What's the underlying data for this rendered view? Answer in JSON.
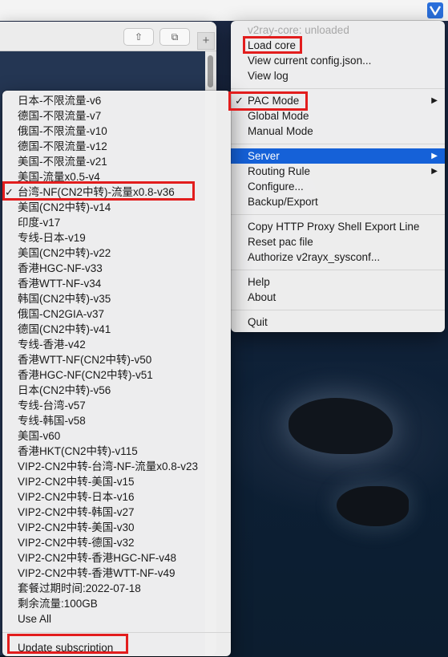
{
  "main_menu": {
    "status": "v2ray-core: unloaded",
    "items_top": [
      "Load core",
      "View current config.json...",
      "View log"
    ],
    "pac_mode": "PAC Mode",
    "global_mode": "Global Mode",
    "manual_mode": "Manual Mode",
    "server": "Server",
    "routing_rule": "Routing Rule",
    "configure": "Configure...",
    "backup_export": "Backup/Export",
    "copy_proxy": "Copy HTTP Proxy Shell Export Line",
    "reset_pac": "Reset pac file",
    "authorize": "Authorize v2rayx_sysconf...",
    "help": "Help",
    "about": "About",
    "quit": "Quit"
  },
  "server_menu": {
    "items": [
      "日本-不限流量-v6",
      "德国-不限流量-v7",
      "俄国-不限流量-v10",
      "德国-不限流量-v12",
      "美国-不限流量-v21",
      "美国-流量x0.5-v4",
      "台湾-NF(CN2中转)-流量x0.8-v36",
      "美国(CN2中转)-v14",
      "印度-v17",
      "专线-日本-v19",
      "美国(CN2中转)-v22",
      "香港HGC-NF-v33",
      "香港WTT-NF-v34",
      "韩国(CN2中转)-v35",
      "俄国-CN2GIA-v37",
      "德国(CN2中转)-v41",
      "专线-香港-v42",
      "香港WTT-NF(CN2中转)-v50",
      "香港HGC-NF(CN2中转)-v51",
      "日本(CN2中转)-v56",
      "专线-台湾-v57",
      "专线-韩国-v58",
      "美国-v60",
      "香港HKT(CN2中转)-v115",
      "VIP2-CN2中转-台湾-NF-流量x0.8-v23",
      "VIP2-CN2中转-美国-v15",
      "VIP2-CN2中转-日本-v16",
      "VIP2-CN2中转-韩国-v27",
      "VIP2-CN2中转-美国-v30",
      "VIP2-CN2中转-德国-v32",
      "VIP2-CN2中转-香港HGC-NF-v48",
      "VIP2-CN2中转-香港WTT-NF-v49",
      "套餐过期时间:2022-07-18",
      "剩余流量:100GB",
      "Use All",
      "Update subscription"
    ],
    "selected_index": 6
  },
  "glyphs": {
    "check": "✓",
    "submenu_arrow": "▶",
    "share": "⇧",
    "tabs": "⧉",
    "plus": "+"
  },
  "colors": {
    "highlight": "#1561d8",
    "annotation_red": "#e21d1d"
  }
}
